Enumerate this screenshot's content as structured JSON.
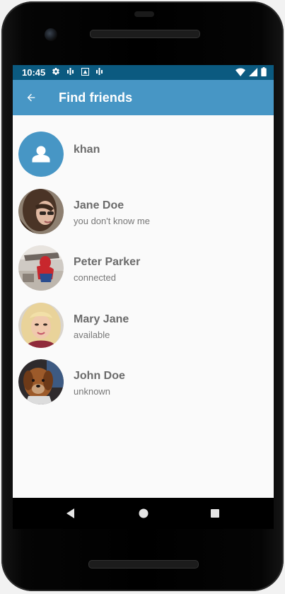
{
  "status_bar": {
    "time": "10:45",
    "left_icons": [
      "gear-icon",
      "sim-icon",
      "android-icon",
      "sim-icon"
    ],
    "right_icons": [
      "wifi-icon",
      "signal-icon",
      "battery-icon"
    ]
  },
  "app_bar": {
    "title": "Find friends",
    "back_icon": "arrow-left-icon",
    "color": "#4796c5",
    "status_color": "#0b5a80"
  },
  "contacts": [
    {
      "name": "khan",
      "status": "",
      "avatar": "default-person-icon"
    },
    {
      "name": "Jane Doe",
      "status": "you don't know me",
      "avatar": "photo"
    },
    {
      "name": "Peter Parker",
      "status": "connected",
      "avatar": "photo"
    },
    {
      "name": "Mary Jane",
      "status": "available",
      "avatar": "photo"
    },
    {
      "name": "John Doe",
      "status": "unknown",
      "avatar": "photo"
    }
  ],
  "nav_bar": {
    "icons": [
      "back-triangle-icon",
      "home-circle-icon",
      "recents-square-icon"
    ]
  }
}
